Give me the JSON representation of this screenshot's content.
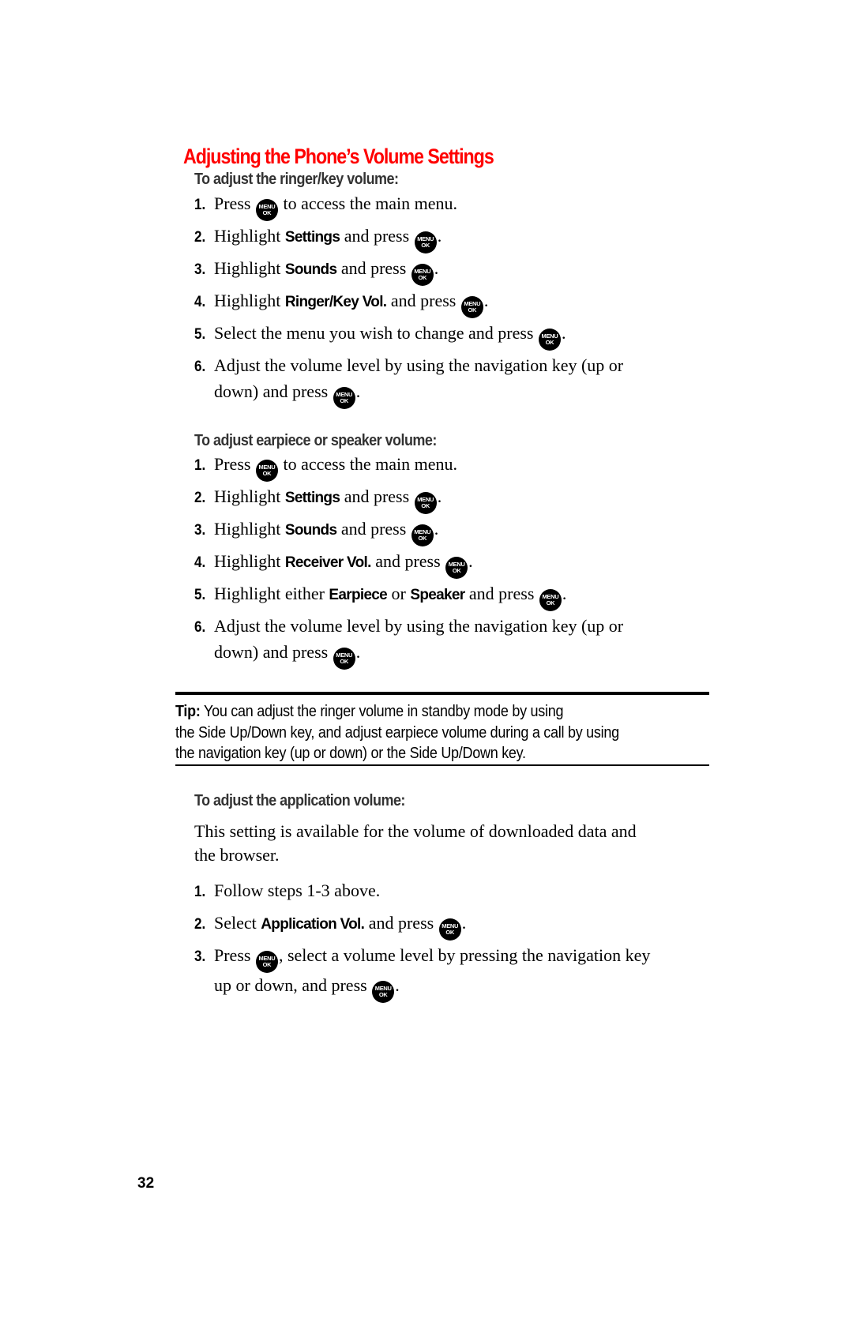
{
  "page": {
    "title": "Adjusting the Phone’s Volume Settings",
    "page_number": "32",
    "icon_label_top": "MENU",
    "icon_label_bottom": "OK",
    "title_color": "#ff0000"
  },
  "ringer_section": {
    "heading": "To adjust the ringer/key volume:",
    "steps": [
      {
        "num": "1.",
        "pre": "Press ",
        "post": " to access the main menu."
      },
      {
        "num": "2.",
        "pre": "Highlight ",
        "bold": "Settings",
        "mid": " and press ",
        "post": "."
      },
      {
        "num": "3.",
        "pre": "Highlight ",
        "bold": "Sounds",
        "mid": " and press ",
        "post": "."
      },
      {
        "num": "4.",
        "pre": "Highlight ",
        "bold": "Ringer/Key Vol.",
        "mid": " and press ",
        "post": "."
      },
      {
        "num": "5.",
        "pre": "Select the menu you wish to change and press ",
        "post": "."
      },
      {
        "num": "6.",
        "pre": "Adjust the volume level by using the navigation key (up or",
        "line2_pre": "down) and press ",
        "post": "."
      }
    ]
  },
  "earpiece_section": {
    "heading": "To adjust earpiece or speaker volume:",
    "steps": [
      {
        "num": "1.",
        "pre": "Press ",
        "post": " to access the main menu."
      },
      {
        "num": "2.",
        "pre": "Highlight ",
        "bold": "Settings",
        "mid": " and press ",
        "post": "."
      },
      {
        "num": "3.",
        "pre": "Highlight ",
        "bold": "Sounds",
        "mid": " and press ",
        "post": "."
      },
      {
        "num": "4.",
        "pre": "Highlight ",
        "bold": "Receiver Vol.",
        "mid": " and press ",
        "post": "."
      },
      {
        "num": "5.",
        "pre": "Highlight either ",
        "bold": "Earpiece",
        "mid1": " or ",
        "bold2": "Speaker",
        "mid": " and press ",
        "post": "."
      },
      {
        "num": "6.",
        "pre": "Adjust the volume level by using the navigation key (up or",
        "line2_pre": "down) and press ",
        "post": "."
      }
    ]
  },
  "tip": {
    "label": "Tip:",
    "line1": " You can adjust the ringer volume in standby mode by using",
    "line2": "the Side Up/Down key, and adjust earpiece volume during a call by using",
    "line3": "the navigation key (up or down) or the Side Up/Down key."
  },
  "application_section": {
    "heading": "To adjust the application volume:",
    "intro_line1": "This setting is available for the volume of downloaded data and",
    "intro_line2": "the browser.",
    "steps": [
      {
        "num": "1.",
        "pre": "Follow steps 1-3 above."
      },
      {
        "num": "2.",
        "pre": "Select ",
        "bold": "Application Vol.",
        "mid": " and press ",
        "post": "."
      },
      {
        "num": "3.",
        "pre": "Press ",
        "post": ", select a volume level by pressing the navigation key",
        "line2_pre": "up or down, and press ",
        "line2_post": "."
      }
    ]
  }
}
